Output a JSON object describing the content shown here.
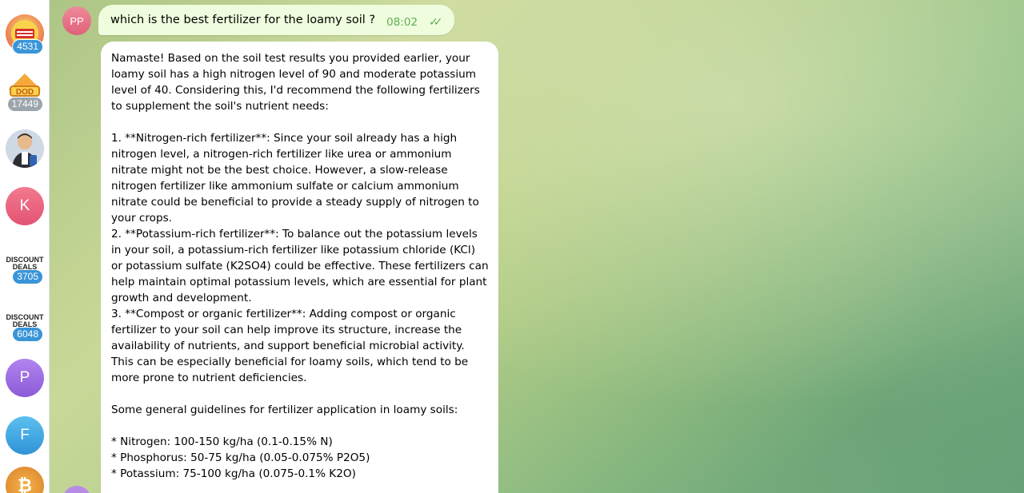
{
  "sidebar": {
    "items": [
      {
        "type": "image",
        "name": "festival-channel",
        "badge": "4531",
        "badge_muted": false,
        "colors": [
          "#f3c94a",
          "#e24a3b"
        ]
      },
      {
        "type": "image",
        "name": "dod-channel",
        "badge": "17449",
        "badge_muted": true,
        "colors": [
          "#f0a330",
          "#fbd34a"
        ]
      },
      {
        "type": "image",
        "name": "character-channel",
        "badge": "",
        "colors": [
          "#6d4c3a",
          "#2e64b3"
        ]
      },
      {
        "type": "letter",
        "letter": "K",
        "color": "#ee5f7a"
      },
      {
        "type": "logo",
        "logo_text": "DISCOUNT DEALS",
        "badge": "3705",
        "badge_muted": false
      },
      {
        "type": "logo",
        "logo_text": "DISCOUNT DEALS",
        "badge": "6048",
        "badge_muted": false
      },
      {
        "type": "letter",
        "letter": "P",
        "color": "#9b6bdf"
      },
      {
        "type": "letter",
        "letter": "F",
        "color": "#3ea6e0"
      },
      {
        "type": "image",
        "name": "bitcoin-channel",
        "badge": "",
        "colors": [
          "#f2a93b",
          "#d9822b"
        ]
      }
    ]
  },
  "conversation": {
    "user_initials": "PP",
    "outgoing": {
      "text": "which is the best fertilizer for the loamy soil ?",
      "time": "08:02",
      "status": "read"
    },
    "incoming": {
      "text": "Namaste! Based on the soil test results you provided earlier, your loamy soil has a high nitrogen level of 90 and moderate potassium level of 40. Considering this, I'd recommend the following fertilizers to supplement the soil's nutrient needs:\n\n1. **Nitrogen-rich fertilizer**: Since your soil already has a high nitrogen level, a nitrogen-rich fertilizer like urea or ammonium nitrate might not be the best choice. However, a slow-release nitrogen fertilizer like ammonium sulfate or calcium ammonium nitrate could be beneficial to provide a steady supply of nitrogen to your crops.\n2. **Potassium-rich fertilizer**: To balance out the potassium levels in your soil, a potassium-rich fertilizer like potassium chloride (KCl) or potassium sulfate (K2SO4) could be effective. These fertilizers can help maintain optimal potassium levels, which are essential for plant growth and development.\n3. **Compost or organic fertilizer**: Adding compost or organic fertilizer to your soil can help improve its structure, increase the availability of nutrients, and support beneficial microbial activity. This can be especially beneficial for loamy soils, which tend to be more prone to nutrient deficiencies.\n\nSome general guidelines for fertilizer application in loamy soils:\n\n* Nitrogen: 100-150 kg/ha (0.1-0.15% N)\n* Phosphorus: 50-75 kg/ha (0.05-0.075% P2O5)\n* Potassium: 75-100 kg/ha (0.075-0.1% K2O)"
    }
  },
  "colors": {
    "outgoing_bubble": "#effdde",
    "incoming_bubble": "#ffffff",
    "time_and_check": "#5fae52",
    "badge": "#3a95d8",
    "badge_muted": "#9aa5ad"
  }
}
